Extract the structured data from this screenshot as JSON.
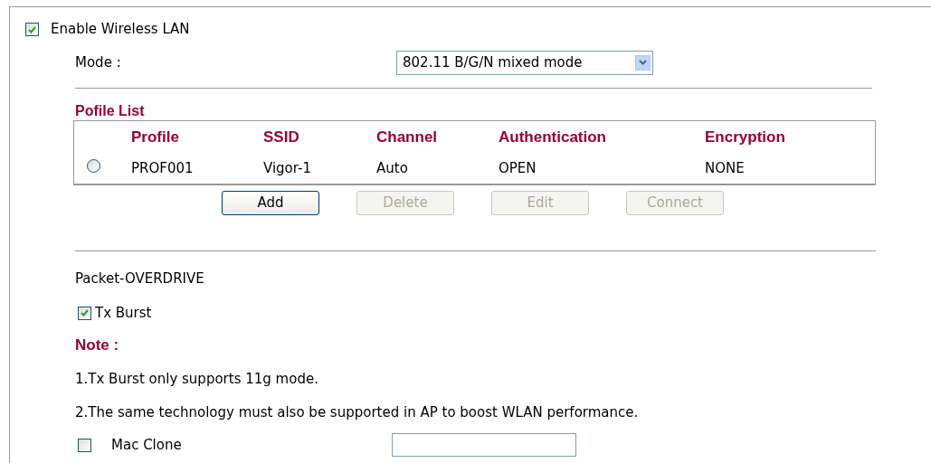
{
  "enable_wlan": {
    "label": "Enable Wireless LAN",
    "checked": true
  },
  "mode": {
    "label": "Mode :",
    "value": "802.11 B/G/N mixed mode"
  },
  "profile_list": {
    "title": "Pofile List",
    "columns": [
      "Profile",
      "SSID",
      "Channel",
      "Authentication",
      "Encryption"
    ],
    "rows": [
      {
        "selected": false,
        "cells": [
          "PROF001",
          "Vigor-1",
          "Auto",
          "OPEN",
          "NONE"
        ]
      }
    ]
  },
  "buttons": [
    {
      "label": "Add",
      "disabled": false
    },
    {
      "label": "Delete",
      "disabled": true
    },
    {
      "label": "Edit",
      "disabled": true
    },
    {
      "label": "Connect",
      "disabled": true
    }
  ],
  "packet_overdrive": {
    "label": "Packet-OVERDRIVE"
  },
  "tx_burst": {
    "label": "Tx Burst",
    "checked": true
  },
  "note": {
    "title": "Note :",
    "lines": [
      "1.Tx Burst only supports 11g mode.",
      "2.The same technology must also be supported in AP to boost WLAN performance."
    ]
  },
  "mac_clone": {
    "label": "Mac Clone",
    "checked": false
  }
}
